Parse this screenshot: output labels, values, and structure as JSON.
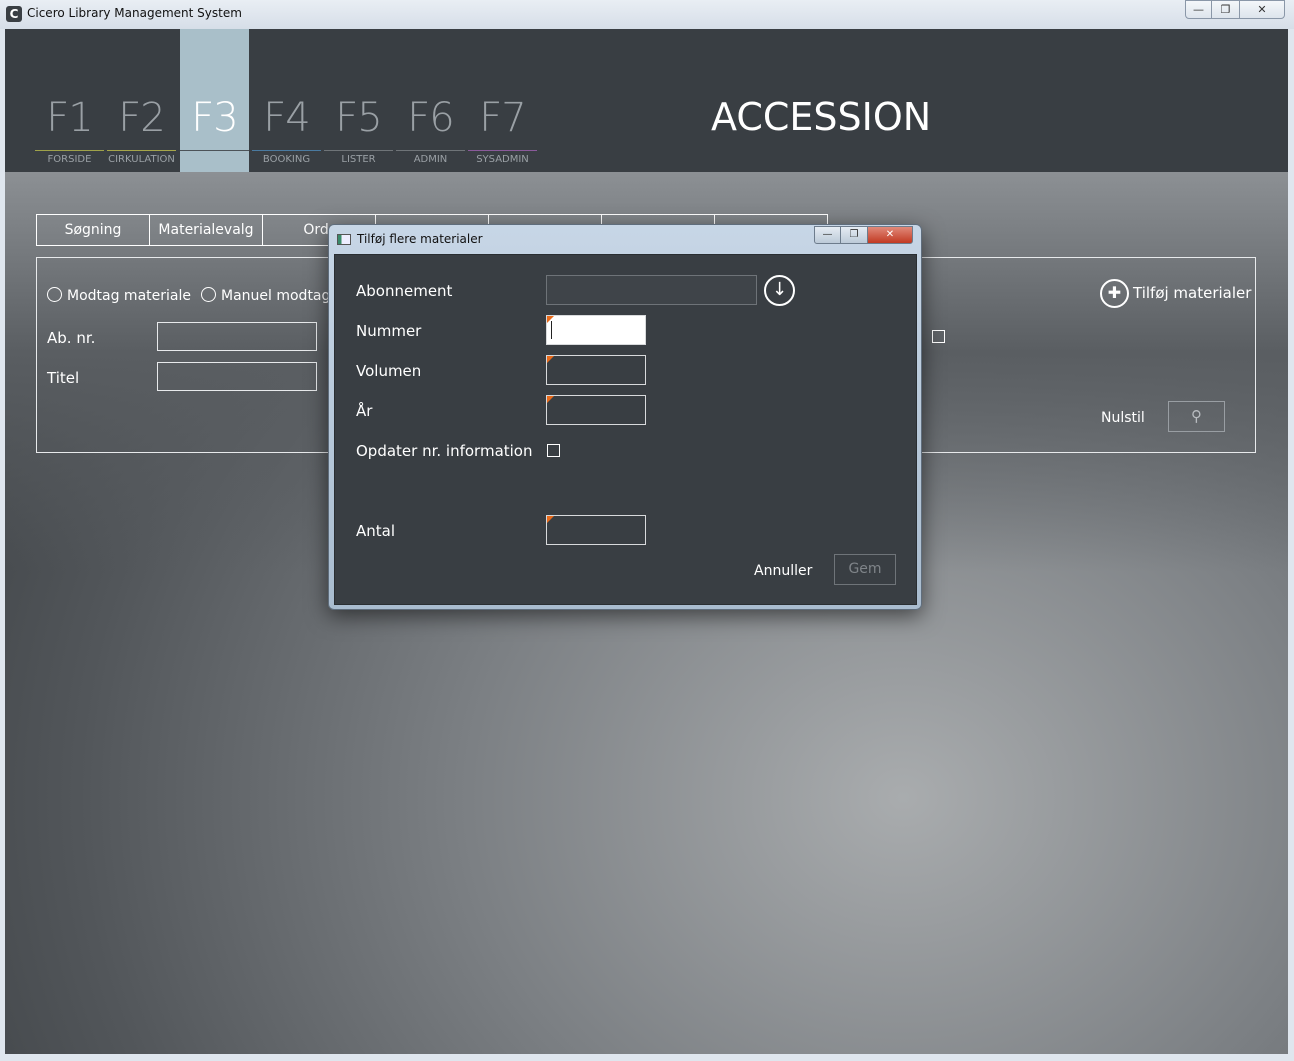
{
  "window": {
    "title": "Cicero Library Management System",
    "app_icon": "C",
    "min_glyph": "—",
    "max_glyph": "❐",
    "close_glyph": "✕"
  },
  "nav": {
    "keys": [
      {
        "key": "F1",
        "label": "FORSIDE",
        "accent": "#9fa24a"
      },
      {
        "key": "F2",
        "label": "CIRKULATION",
        "accent": "#a6a64a"
      },
      {
        "key": "F3",
        "label": "",
        "accent": "#ffffff"
      },
      {
        "key": "F4",
        "label": "BOOKING",
        "accent": "#4a7aa0"
      },
      {
        "key": "F5",
        "label": "LISTER",
        "accent": "#6f7478"
      },
      {
        "key": "F6",
        "label": "ADMIN",
        "accent": "#6f7478"
      },
      {
        "key": "F7",
        "label": "SYSADMIN",
        "accent": "#8a5a9a"
      }
    ],
    "active": "F3"
  },
  "page_title": "ACCESSION",
  "tabs": [
    "Søgning",
    "Materialevalg",
    "Ordr"
  ],
  "panel": {
    "radio_receive": "Modtag materiale",
    "radio_manual": "Manuel modtage",
    "ab_nr_label": "Ab. nr.",
    "title_label": "Titel",
    "add_materials": "Tilføj materialer",
    "add_icon": "add-circle-icon",
    "reset": "Nulstil",
    "search_icon": "search-icon"
  },
  "dialog": {
    "title": "Tilføj flere materialer",
    "fields": {
      "abonnement": "Abonnement",
      "nummer": "Nummer",
      "volumen": "Volumen",
      "aar": "År",
      "opdater": "Opdater nr. information",
      "antal": "Antal"
    },
    "cancel": "Annuller",
    "save": "Gem",
    "required_marker_color": "#e86a1a"
  }
}
